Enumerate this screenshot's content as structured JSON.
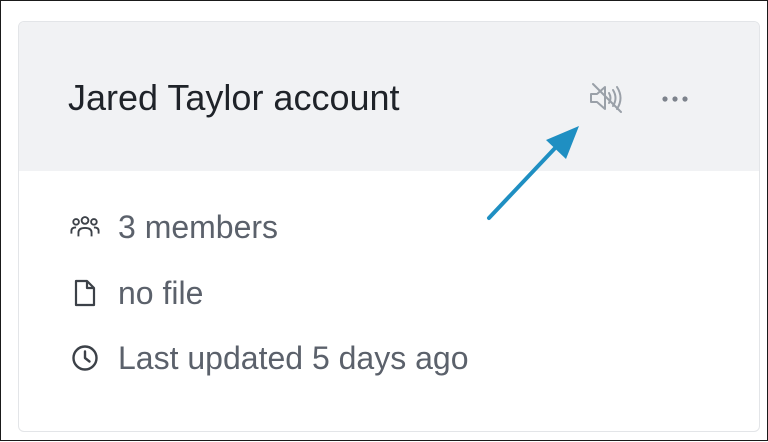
{
  "card": {
    "title": "Jared Taylor account",
    "actions": {
      "mute_icon": "speaker-muted-icon",
      "more_icon": "ellipsis-horizontal-icon"
    },
    "meta": {
      "members": "3 members",
      "file": "no file",
      "updated": "Last updated 5 days ago"
    }
  },
  "annotation": {
    "arrow_color": "#1f8fc2",
    "points_to": "mute-button"
  },
  "colors": {
    "header_bg": "#f1f2f4",
    "title": "#1f2329",
    "meta_text": "#5b616b",
    "icon_muted": "#9aa0a8"
  }
}
